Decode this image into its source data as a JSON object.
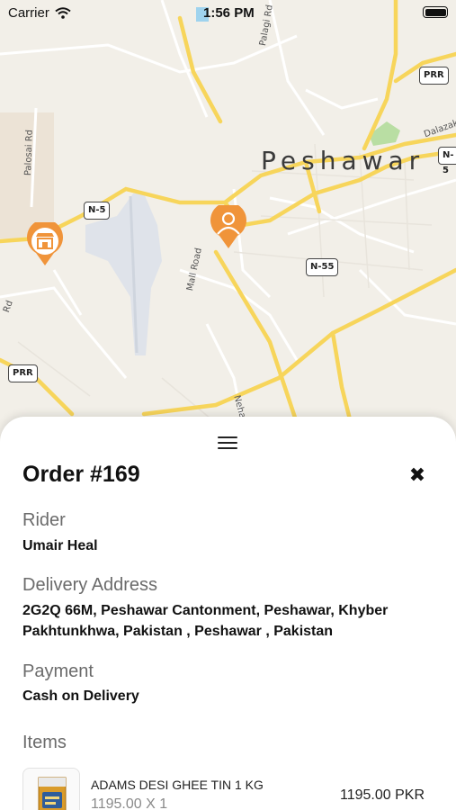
{
  "status_bar": {
    "carrier": "Carrier",
    "time": "1:56 PM"
  },
  "map": {
    "city": "Peshawar",
    "shields": [
      "N-5",
      "N-55",
      "PRR",
      "PRR",
      "N-5"
    ],
    "road_names": [
      "Palosai Rd",
      "Mall Road",
      "Palagi Rd",
      "Dalazak Rd",
      "Neha",
      "Rd"
    ],
    "store_pin_icon": "store-icon",
    "rider_pin_icon": "person-icon",
    "pin_color": "#f0943a"
  },
  "sheet": {
    "handle_icon": "menu-icon",
    "order_title": "Order #169",
    "close_icon": "close-icon",
    "rider_label": "Rider",
    "rider_name": "Umair Heal",
    "address_label": "Delivery Address",
    "address_line1": "2G2Q 66M, Peshawar Cantonment, Peshawar, Khyber",
    "address_line2": "Pakhtunkhwa, Pakistan , Peshawar , Pakistan",
    "payment_label": "Payment",
    "payment_value": "Cash on Delivery",
    "items_label": "Items",
    "items": [
      {
        "name": "ADAMS DESI GHEE TIN 1 KG",
        "qty": "1195.00 X 1",
        "price": "1195.00 PKR"
      }
    ]
  }
}
